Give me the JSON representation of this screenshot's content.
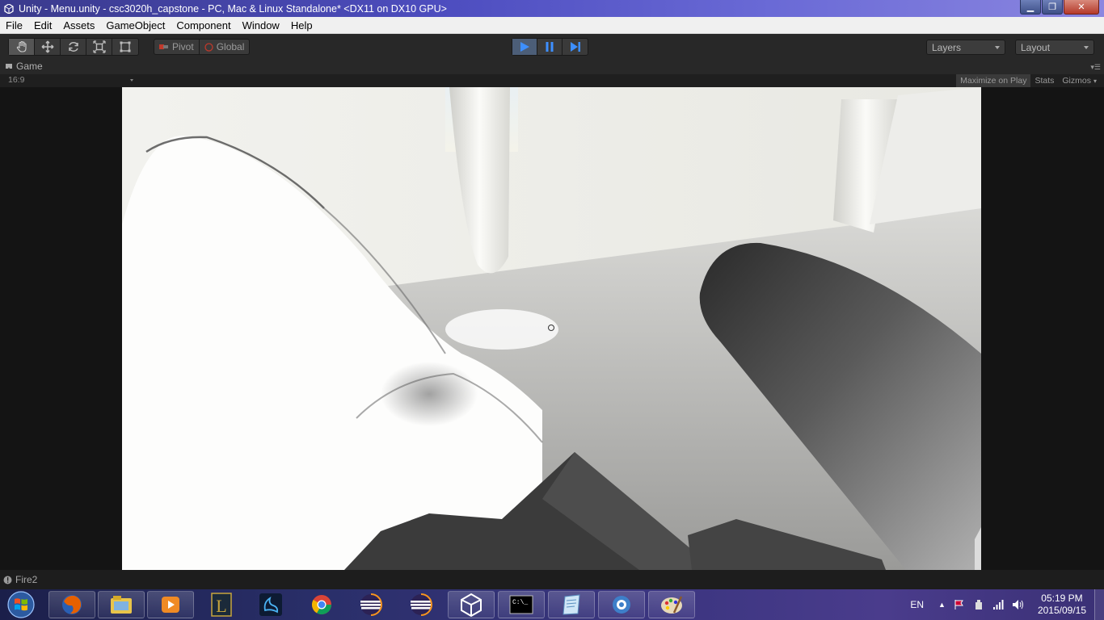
{
  "window": {
    "title": "Unity - Menu.unity - csc3020h_capstone - PC, Mac & Linux Standalone* <DX11 on DX10 GPU>",
    "minimize_glyph": "▁",
    "maximize_glyph": "❐",
    "close_glyph": "✕"
  },
  "menu": [
    "File",
    "Edit",
    "Assets",
    "GameObject",
    "Component",
    "Window",
    "Help"
  ],
  "toolbar": {
    "transform_tools": [
      "hand-icon",
      "move-icon",
      "rotate-icon",
      "scale-icon",
      "rect-icon"
    ],
    "pivot_label": "Pivot",
    "global_label": "Global",
    "layers_label": "Layers",
    "layout_label": "Layout"
  },
  "game_view": {
    "tab_label": "Game",
    "aspect": "16:9",
    "maximize_on_play": "Maximize on Play",
    "stats": "Stats",
    "gizmos": "Gizmos"
  },
  "status": {
    "message": "Fire2"
  },
  "taskbar": {
    "apps": [
      "firefox-icon",
      "file-explorer-icon",
      "media-player-icon",
      "league-of-legends-icon",
      "battle-net-icon",
      "chrome-icon",
      "eclipse-icon",
      "eclipse-icon",
      "unity-icon",
      "command-prompt-icon",
      "notepad-icon",
      "network-icon",
      "paint-icon"
    ],
    "language": "EN",
    "time": "05:19 PM",
    "date": "2015/09/15"
  },
  "colors": {
    "play_active": "#4c5e78",
    "accent_blue": "#3d8fff"
  }
}
